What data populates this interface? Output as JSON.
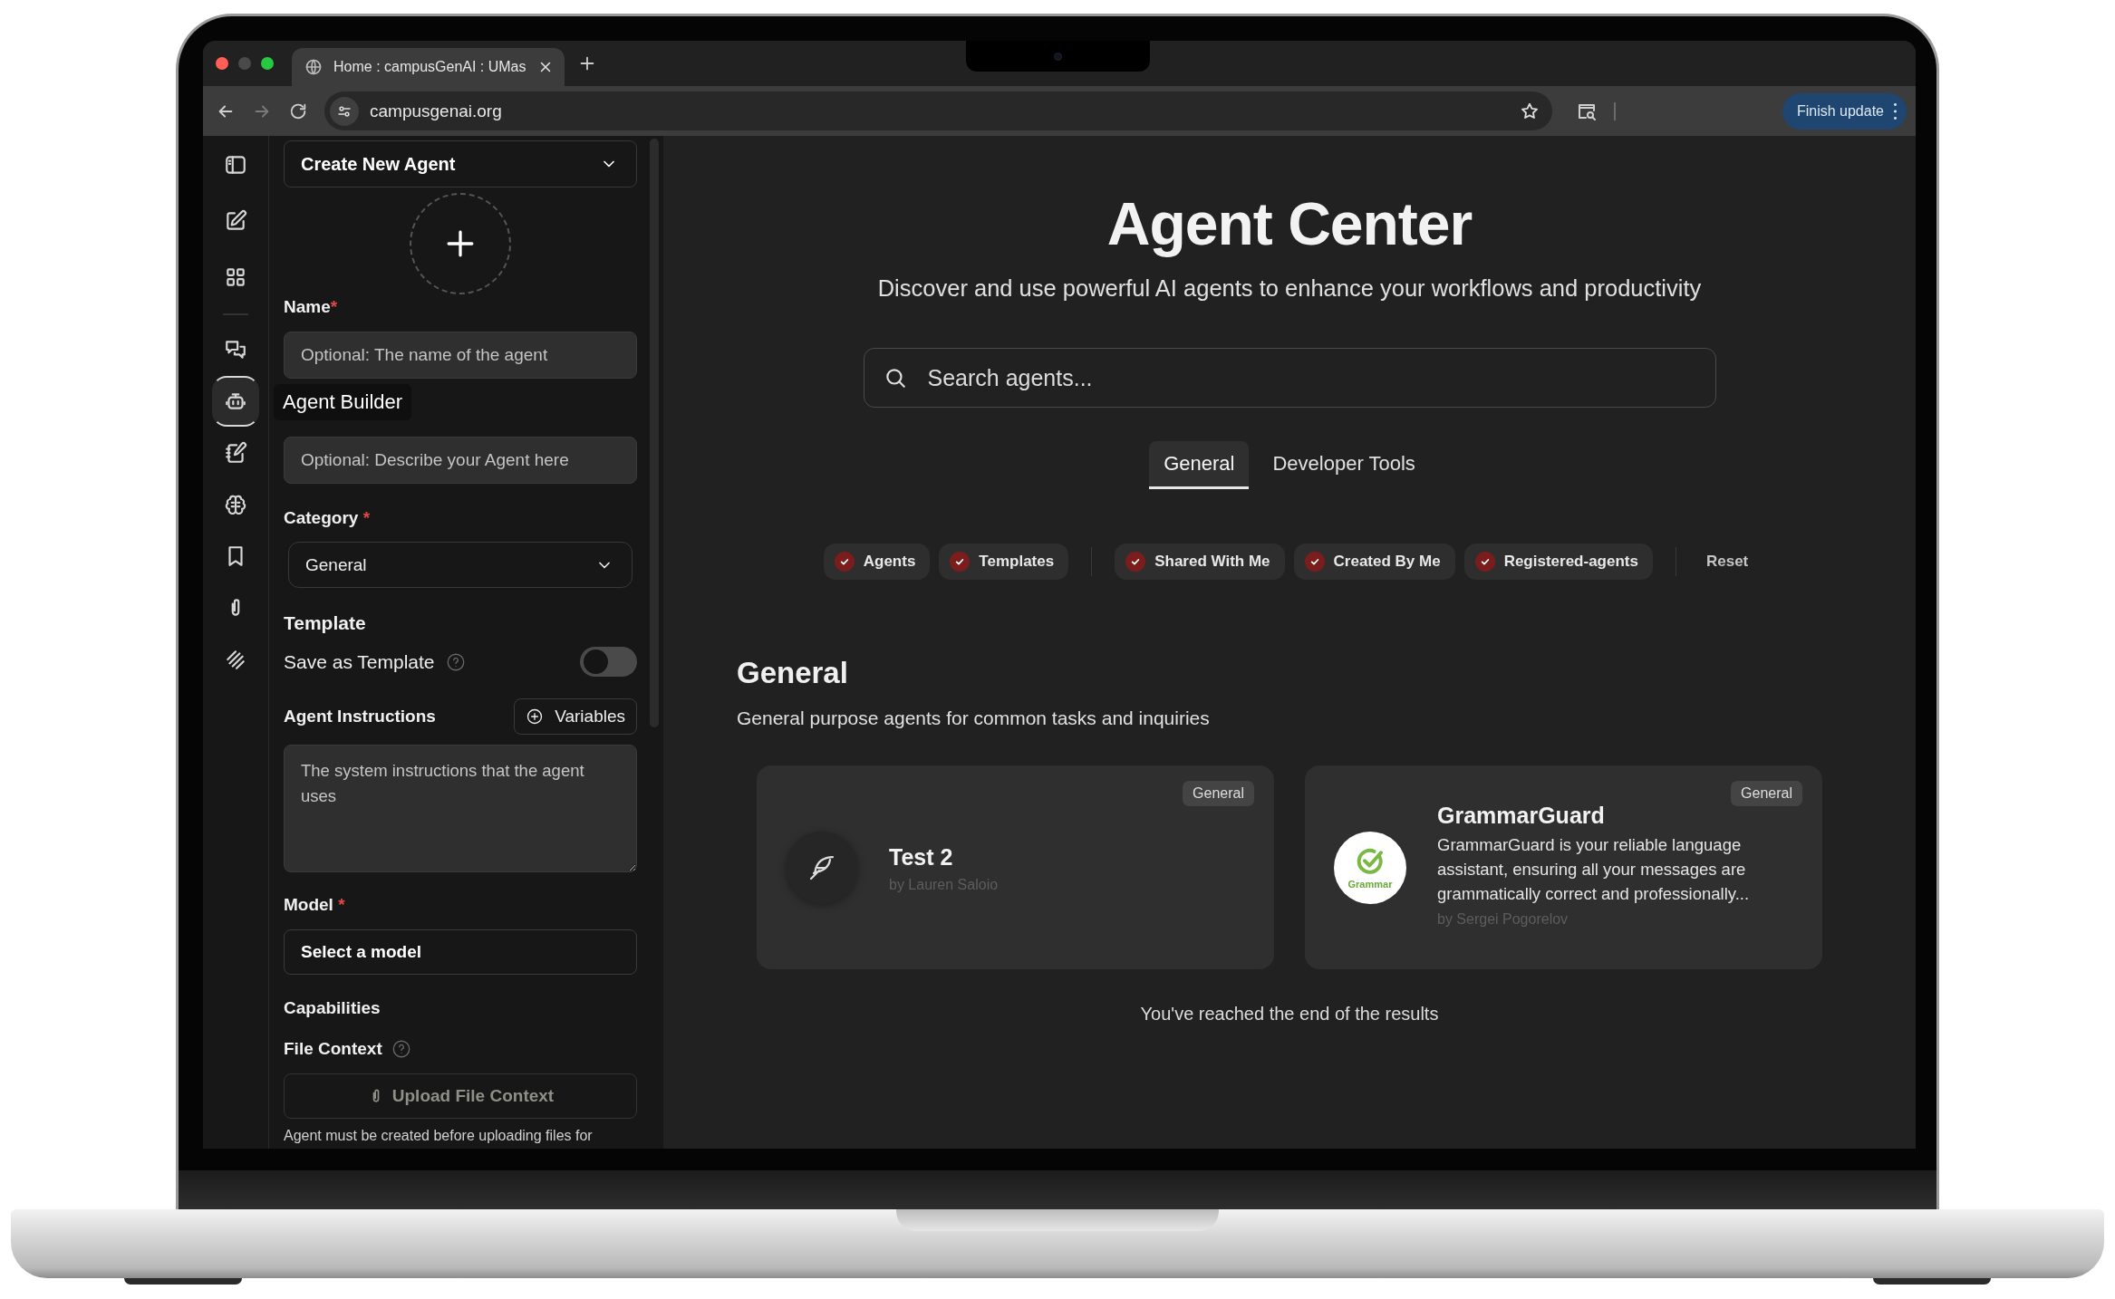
{
  "browser": {
    "tab_title": "Home : campusGenAI : UMas",
    "address": "campusgenai.org",
    "update_button": "Finish update"
  },
  "rail": {
    "groups": [
      [
        {
          "selected": false
        },
        {
          "selected": false
        },
        {
          "selected": false
        }
      ],
      [
        {
          "selected": false
        },
        {
          "selected": true
        },
        {
          "selected": false
        },
        {
          "selected": false
        },
        {
          "selected": false
        },
        {
          "selected": false
        },
        {
          "selected": false
        }
      ]
    ],
    "tooltip": "Agent Builder"
  },
  "builder": {
    "agent_select": "Create New Agent",
    "name": {
      "label": "Name",
      "required_mark": "*",
      "placeholder": "Optional: The name of the agent"
    },
    "description": {
      "placeholder": "Optional: Describe your Agent here"
    },
    "category": {
      "label": "Category",
      "required_mark": " *",
      "value": "General"
    },
    "template": {
      "heading": "Template",
      "label": "Save as Template",
      "on": false
    },
    "instructions": {
      "label": "Agent Instructions",
      "variables_button": "Variables",
      "placeholder": "The system instructions that the agent uses"
    },
    "model": {
      "label": "Model",
      "required_mark": " *",
      "value": "Select a model"
    },
    "capabilities": {
      "heading": "Capabilities",
      "file_context_label": "File Context",
      "upload_button": "Upload File Context",
      "note": "Agent must be created before uploading files for"
    }
  },
  "main": {
    "title": "Agent Center",
    "subtitle": "Discover and use powerful AI agents to enhance your workflows and productivity",
    "search": {
      "placeholder": "Search agents..."
    },
    "tabs": [
      {
        "label": "General",
        "selected": true
      },
      {
        "label": "Developer Tools",
        "selected": false
      }
    ],
    "filter_groups": [
      [
        {
          "label": "Agents",
          "checked": true
        },
        {
          "label": "Templates",
          "checked": true
        }
      ],
      [
        {
          "label": "Shared With Me",
          "checked": true
        },
        {
          "label": "Created By Me",
          "checked": true
        },
        {
          "label": "Registered-agents",
          "checked": true
        }
      ]
    ],
    "reset": "Reset",
    "section": {
      "title": "General",
      "description": "General purpose agents for common tasks and inquiries",
      "cards": [
        {
          "kind": "icon",
          "name": "Test 2",
          "author": "by Lauren Saloio",
          "category": "General"
        },
        {
          "kind": "logo",
          "name": "GrammarGuard",
          "logo_text": "Grammar",
          "description": "GrammarGuard is your reliable language assistant, ensuring all your messages are grammatically correct and professionally...",
          "author": "by Sergei Pogorelov",
          "category": "General"
        }
      ]
    },
    "end_text": "You've reached the end of the results"
  }
}
